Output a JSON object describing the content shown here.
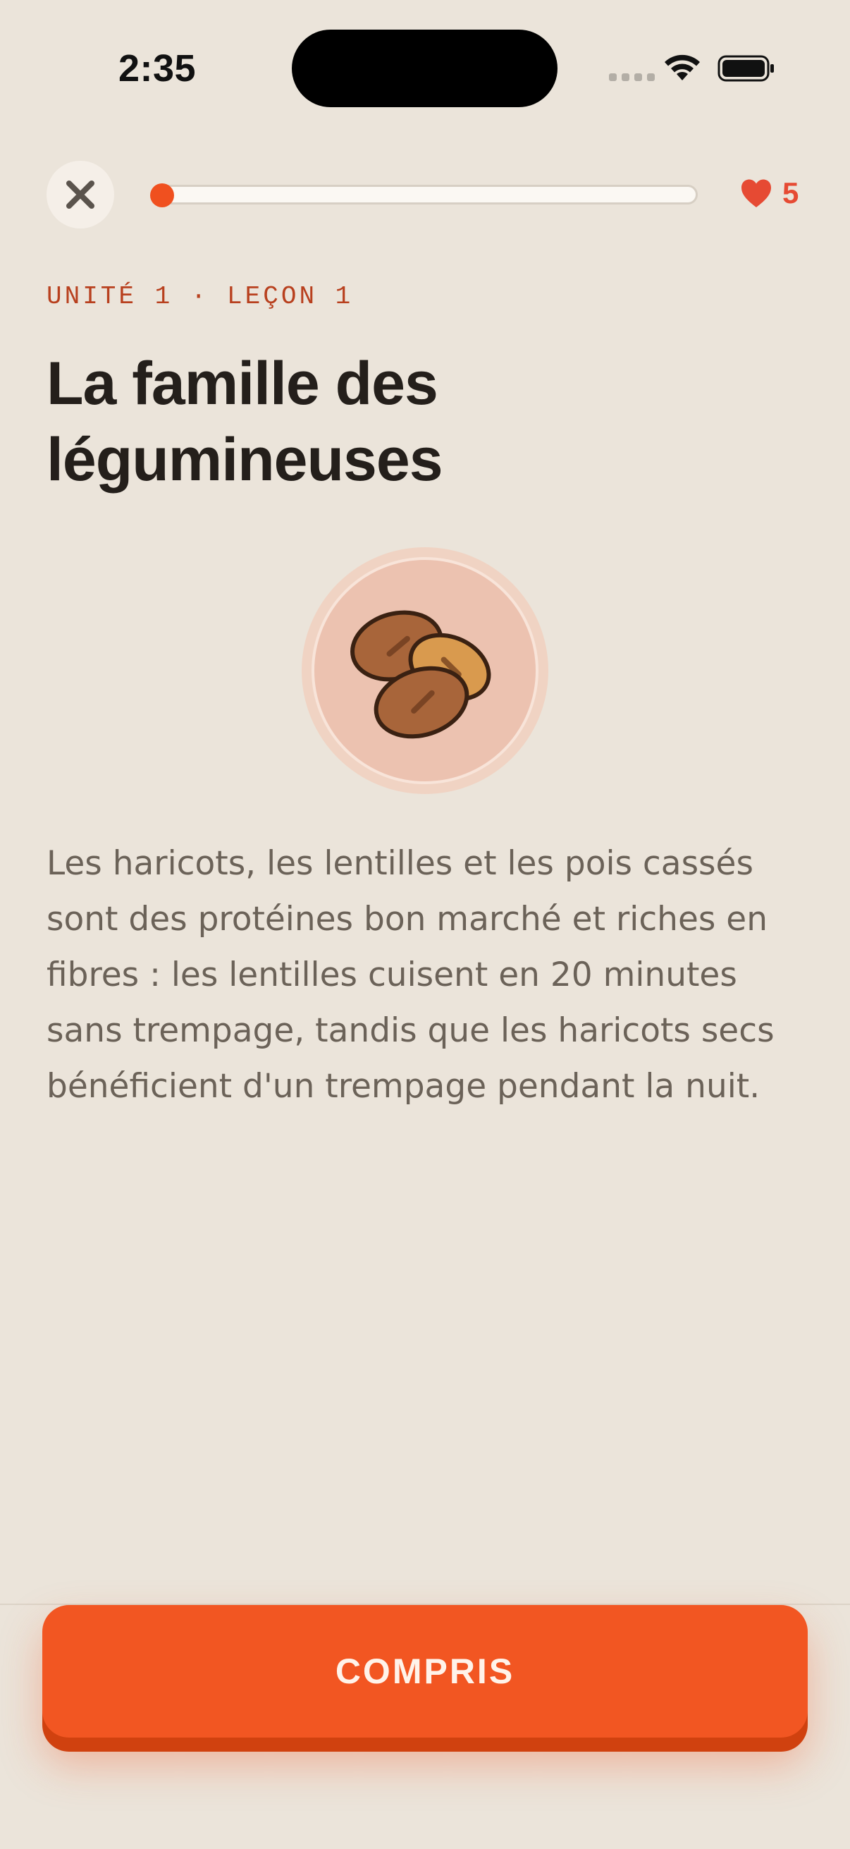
{
  "status_bar": {
    "time": "2:35"
  },
  "top_bar": {
    "progress_fraction": 0.02,
    "hearts_count": "5",
    "accent_color": "#f0501f",
    "heart_color": "#e64a33"
  },
  "lesson": {
    "eyebrow": "UNITÉ 1 · LEÇON 1",
    "title": "La famille des légumineuses",
    "illustration_icon": "beans-icon",
    "body": "Les haricots, les lentilles et les pois cassés sont des protéines bon marché et riches en fibres : les lentilles cuisent en 20 minutes sans trempage, tandis que les haricots secs bénéficient d'un trempage pendant la nuit."
  },
  "footer": {
    "cta_label": "COMPRIS",
    "cta_color": "#f25622"
  }
}
